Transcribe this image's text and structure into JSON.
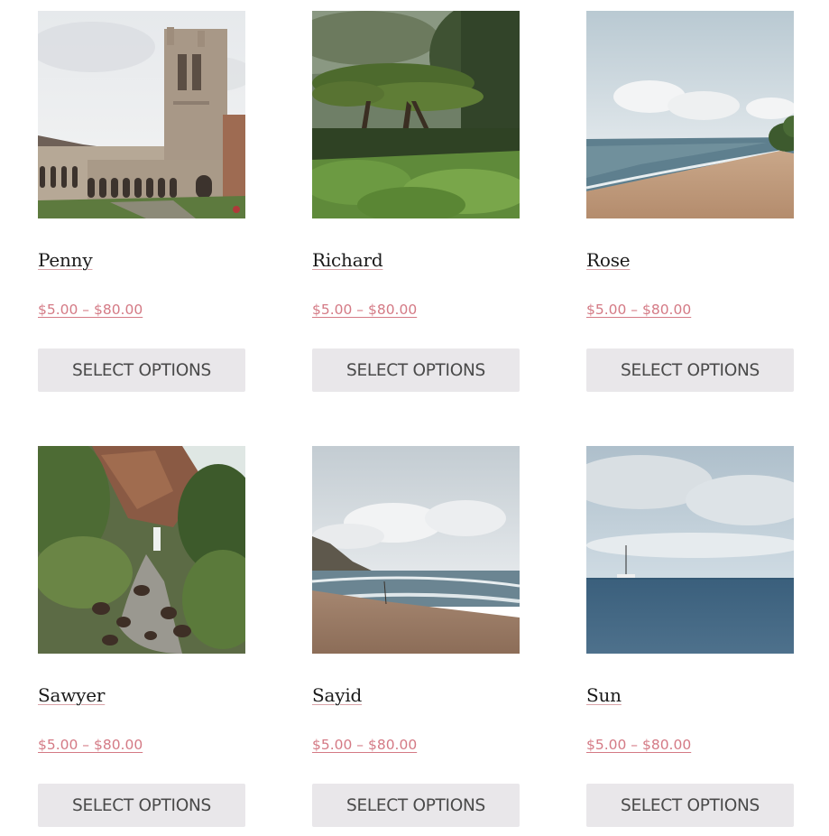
{
  "products": [
    {
      "name": "Penny",
      "price": "$5.00 – $80.00",
      "button": "SELECT OPTIONS",
      "image": "church-tower-photo"
    },
    {
      "name": "Richard",
      "price": "$5.00 – $80.00",
      "button": "SELECT OPTIONS",
      "image": "jungle-tree-photo"
    },
    {
      "name": "Rose",
      "price": "$5.00 – $80.00",
      "button": "SELECT OPTIONS",
      "image": "beach-shore-photo"
    },
    {
      "name": "Sawyer",
      "price": "$5.00 – $80.00",
      "button": "SELECT OPTIONS",
      "image": "waterfall-stream-photo"
    },
    {
      "name": "Sayid",
      "price": "$5.00 – $80.00",
      "button": "SELECT OPTIONS",
      "image": "cloudy-beach-photo"
    },
    {
      "name": "Sun",
      "price": "$5.00 – $80.00",
      "button": "SELECT OPTIONS",
      "image": "sailboat-ocean-photo"
    }
  ],
  "colors": {
    "price": "#d47a85",
    "button_bg": "#e9e7ea",
    "button_text": "#4a4a4a",
    "title_underline": "#d9a3a8"
  }
}
